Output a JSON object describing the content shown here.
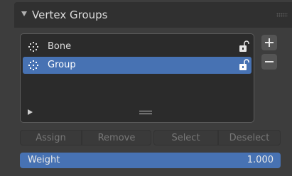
{
  "panel": {
    "title": "Vertex Groups"
  },
  "vertex_groups": {
    "items": [
      {
        "label": "Bone",
        "selected": false,
        "icon": "vertex-group-icon",
        "lock_icon": "unlocked-icon"
      },
      {
        "label": "Group",
        "selected": true,
        "icon": "vertex-group-icon",
        "lock_icon": "unlocked-icon"
      }
    ]
  },
  "side_buttons": {
    "add_icon": "plus-icon",
    "remove_icon": "minus-icon"
  },
  "actions": {
    "assign": "Assign",
    "remove": "Remove",
    "select": "Select",
    "deselect": "Deselect"
  },
  "weight": {
    "label": "Weight",
    "value": "1.000"
  },
  "colors": {
    "accent": "#4772b3",
    "panel_bg": "#3d3d3d",
    "header_bg": "#303030",
    "list_bg": "#2b2b2b"
  }
}
